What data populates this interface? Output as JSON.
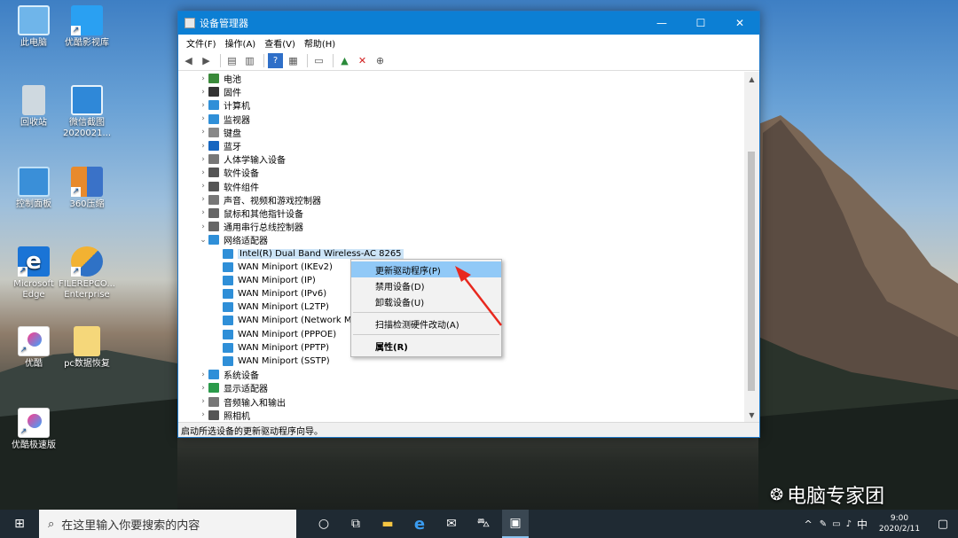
{
  "desktop": {
    "icons": [
      {
        "label": "此电脑",
        "icon": "computer-icon"
      },
      {
        "label": "优酷影视库",
        "icon": "youku-folder-icon"
      },
      {
        "label": "回收站",
        "icon": "recycle-bin-icon"
      },
      {
        "label": "微信截图 2020021...",
        "icon": "screenshot-icon"
      },
      {
        "label": "控制面板",
        "icon": "control-panel-icon"
      },
      {
        "label": "360压缩",
        "icon": "archive-icon"
      },
      {
        "label": "Microsoft Edge",
        "icon": "edge-icon"
      },
      {
        "label": "FILEREPCO... Enterprise",
        "icon": "shield-app-icon"
      },
      {
        "label": "优酷",
        "icon": "youku-icon"
      },
      {
        "label": "pc数据恢复",
        "icon": "folder-icon"
      },
      {
        "label": "优酷极速版",
        "icon": "youku-lite-icon"
      }
    ],
    "watermark": "电脑专家团"
  },
  "window": {
    "title": "设备管理器",
    "minimize": "—",
    "maximize": "☐",
    "close": "✕",
    "menu": [
      "文件(F)",
      "操作(A)",
      "查看(V)",
      "帮助(H)"
    ],
    "toolbar_icons": [
      "back-icon",
      "forward-icon",
      "properties-icon",
      "devices-icon",
      "help-icon",
      "details-icon",
      "monitor-icon",
      "update-driver-icon",
      "uninstall-icon",
      "download-icon"
    ],
    "tree": [
      {
        "label": "电池",
        "expand": "›",
        "icon": "battery-icon",
        "color": "#3a8a3a",
        "level": 0
      },
      {
        "label": "固件",
        "expand": "›",
        "icon": "firmware-icon",
        "color": "#333333",
        "level": 0
      },
      {
        "label": "计算机",
        "expand": "›",
        "icon": "computer-icon",
        "color": "#2f8fd8",
        "level": 0
      },
      {
        "label": "监视器",
        "expand": "›",
        "icon": "monitor-icon",
        "color": "#2f8fd8",
        "level": 0
      },
      {
        "label": "键盘",
        "expand": "›",
        "icon": "keyboard-icon",
        "color": "#888888",
        "level": 0
      },
      {
        "label": "蓝牙",
        "expand": "›",
        "icon": "bluetooth-icon",
        "color": "#1565c0",
        "level": 0
      },
      {
        "label": "人体学输入设备",
        "expand": "›",
        "icon": "hid-icon",
        "color": "#777777",
        "level": 0
      },
      {
        "label": "软件设备",
        "expand": "›",
        "icon": "software-device-icon",
        "color": "#555555",
        "level": 0
      },
      {
        "label": "软件组件",
        "expand": "›",
        "icon": "software-component-icon",
        "color": "#555555",
        "level": 0
      },
      {
        "label": "声音、视频和游戏控制器",
        "expand": "›",
        "icon": "speaker-icon",
        "color": "#777777",
        "level": 0
      },
      {
        "label": "鼠标和其他指针设备",
        "expand": "›",
        "icon": "mouse-icon",
        "color": "#666666",
        "level": 0
      },
      {
        "label": "通用串行总线控制器",
        "expand": "›",
        "icon": "usb-icon",
        "color": "#666666",
        "level": 0
      },
      {
        "label": "网络适配器",
        "expand": "⌄",
        "icon": "network-icon",
        "color": "#2f8fd8",
        "level": 0
      },
      {
        "label": "Intel(R) Dual Band Wireless-AC 8265",
        "expand": "",
        "icon": "network-adapter-icon",
        "color": "#2f8fd8",
        "level": 1,
        "selected": true
      },
      {
        "label": "WAN Miniport (IKEv2)",
        "expand": "",
        "icon": "network-adapter-icon",
        "color": "#2f8fd8",
        "level": 1
      },
      {
        "label": "WAN Miniport (IP)",
        "expand": "",
        "icon": "network-adapter-icon",
        "color": "#2f8fd8",
        "level": 1
      },
      {
        "label": "WAN Miniport (IPv6)",
        "expand": "",
        "icon": "network-adapter-icon",
        "color": "#2f8fd8",
        "level": 1
      },
      {
        "label": "WAN Miniport (L2TP)",
        "expand": "",
        "icon": "network-adapter-icon",
        "color": "#2f8fd8",
        "level": 1
      },
      {
        "label": "WAN Miniport (Network M",
        "expand": "",
        "icon": "network-adapter-icon",
        "color": "#2f8fd8",
        "level": 1
      },
      {
        "label": "WAN Miniport (PPPOE)",
        "expand": "",
        "icon": "network-adapter-icon",
        "color": "#2f8fd8",
        "level": 1
      },
      {
        "label": "WAN Miniport (PPTP)",
        "expand": "",
        "icon": "network-adapter-icon",
        "color": "#2f8fd8",
        "level": 1
      },
      {
        "label": "WAN Miniport (SSTP)",
        "expand": "",
        "icon": "network-adapter-icon",
        "color": "#2f8fd8",
        "level": 1
      },
      {
        "label": "系统设备",
        "expand": "›",
        "icon": "system-device-icon",
        "color": "#2f8fd8",
        "level": 0
      },
      {
        "label": "显示适配器",
        "expand": "›",
        "icon": "display-adapter-icon",
        "color": "#2a9a4a",
        "level": 0
      },
      {
        "label": "音频输入和输出",
        "expand": "›",
        "icon": "audio-icon",
        "color": "#777777",
        "level": 0
      },
      {
        "label": "照相机",
        "expand": "›",
        "icon": "camera-icon",
        "color": "#555555",
        "level": 0
      }
    ],
    "context_menu": [
      {
        "label": "更新驱动程序(P)",
        "type": "item",
        "highlight": true
      },
      {
        "label": "禁用设备(D)",
        "type": "item"
      },
      {
        "label": "卸载设备(U)",
        "type": "item"
      },
      {
        "type": "separator"
      },
      {
        "label": "扫描检测硬件改动(A)",
        "type": "item"
      },
      {
        "type": "separator"
      },
      {
        "label": "属性(R)",
        "type": "item",
        "bold": true
      }
    ],
    "status_text": "启动所选设备的更新驱动程序向导。"
  },
  "taskbar": {
    "start_glyph": "⊞",
    "search_placeholder": "在这里输入你要搜索的内容",
    "apps": [
      {
        "glyph": "○",
        "icon": "cortana-icon"
      },
      {
        "glyph": "⧉",
        "icon": "task-view-icon"
      },
      {
        "glyph": "▬",
        "icon": "file-explorer-icon"
      },
      {
        "glyph": "e",
        "icon": "edge-icon"
      },
      {
        "glyph": "✉",
        "icon": "mail-icon"
      },
      {
        "glyph": "⛍",
        "icon": "store-icon"
      },
      {
        "glyph": "▣",
        "icon": "device-manager-icon",
        "active": true
      }
    ],
    "tray": {
      "chevron": "^",
      "ime": "中",
      "time": "9:00",
      "date": "2020/2/11"
    }
  },
  "colors": {
    "accent": "#0c7fd4",
    "highlight": "#91c9f7",
    "taskbar": "#1f2a33"
  }
}
